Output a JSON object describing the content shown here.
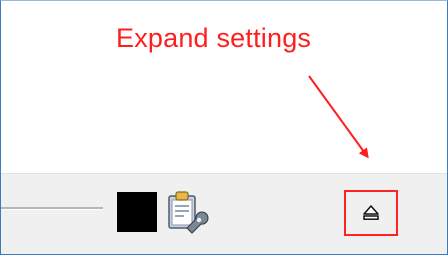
{
  "annotation": {
    "text": "Expand settings",
    "color": "#ff1e1e"
  },
  "toolbar": {
    "background": "#f0f0f0",
    "slider": {
      "icon": "slider-track"
    },
    "color_swatch": {
      "color": "#000000"
    },
    "settings_tool": {
      "icon": "clipboard-wrench-icon"
    },
    "expand_button": {
      "icon": "eject-up-arrow-icon",
      "highlight_color": "#ff2323"
    }
  }
}
